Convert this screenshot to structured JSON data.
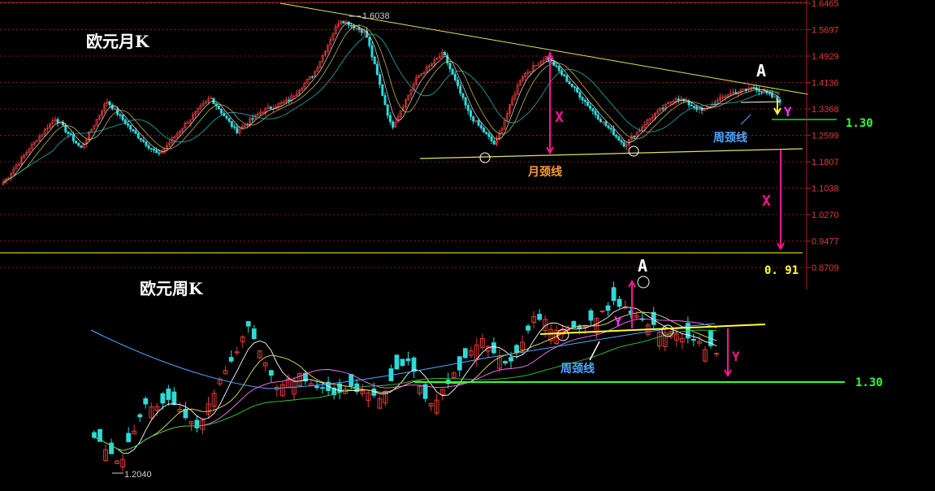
{
  "chart_data": [
    {
      "type": "candlestick",
      "title": "欧元月K",
      "y_ticks": [
        "1.6465",
        "1.5697",
        "1.4929",
        "1.4136",
        "1.3368",
        "1.2599",
        "1.1807",
        "1.1038",
        "1.0270",
        "0.9477",
        "0.8709"
      ],
      "y_tick_values": [
        1.6465,
        1.5697,
        1.4929,
        1.4136,
        1.3368,
        1.2599,
        1.1807,
        1.1038,
        1.027,
        0.9477,
        0.8709
      ],
      "high_label": "1.6038",
      "trendline_label": "月颈线",
      "inner_neckline_label": "周颈线",
      "projection_label": "X",
      "pattern_label": "A",
      "small_move_label": "Y",
      "target_1": "1.30",
      "target_2": "0. 91",
      "approx_close_path": [
        1.12,
        1.22,
        1.31,
        1.22,
        1.36,
        1.27,
        1.2,
        1.29,
        1.37,
        1.27,
        1.33,
        1.36,
        1.44,
        1.6,
        1.56,
        1.28,
        1.43,
        1.5,
        1.32,
        1.23,
        1.43,
        1.49,
        1.4,
        1.31,
        1.23,
        1.31,
        1.37,
        1.33,
        1.38,
        1.4,
        1.36
      ]
    },
    {
      "type": "candlestick",
      "title": "欧元周K",
      "low_label": "1.2040",
      "neckline_label": "周颈线",
      "pattern_label": "A",
      "small_move_label": "Y",
      "target": "1.30",
      "approx_close_path": [
        1.25,
        1.21,
        1.3,
        1.31,
        1.26,
        1.36,
        1.43,
        1.33,
        1.35,
        1.32,
        1.33,
        1.31,
        1.38,
        1.3,
        1.36,
        1.41,
        1.37,
        1.45,
        1.42,
        1.43,
        1.47,
        1.45,
        1.42,
        1.41,
        1.39
      ]
    }
  ],
  "colors": {
    "background": "#000000",
    "axis": "#b02020",
    "grid": "#8a1a1a",
    "up": "#e23a3a",
    "down": "#2fd9d9",
    "trendline": "#e6e05a",
    "neckline_yellow": "#ffff33",
    "magenta": "#ff1493",
    "green": "#33ff33",
    "label_orange": "#ff9933",
    "label_blue": "#4fa8ff",
    "ma_white": "#ffffff",
    "ma_yellow": "#e8e060",
    "ma_pink": "#ff77ff",
    "ma_green": "#33cc33",
    "ma_blue": "#4fa8ff"
  }
}
